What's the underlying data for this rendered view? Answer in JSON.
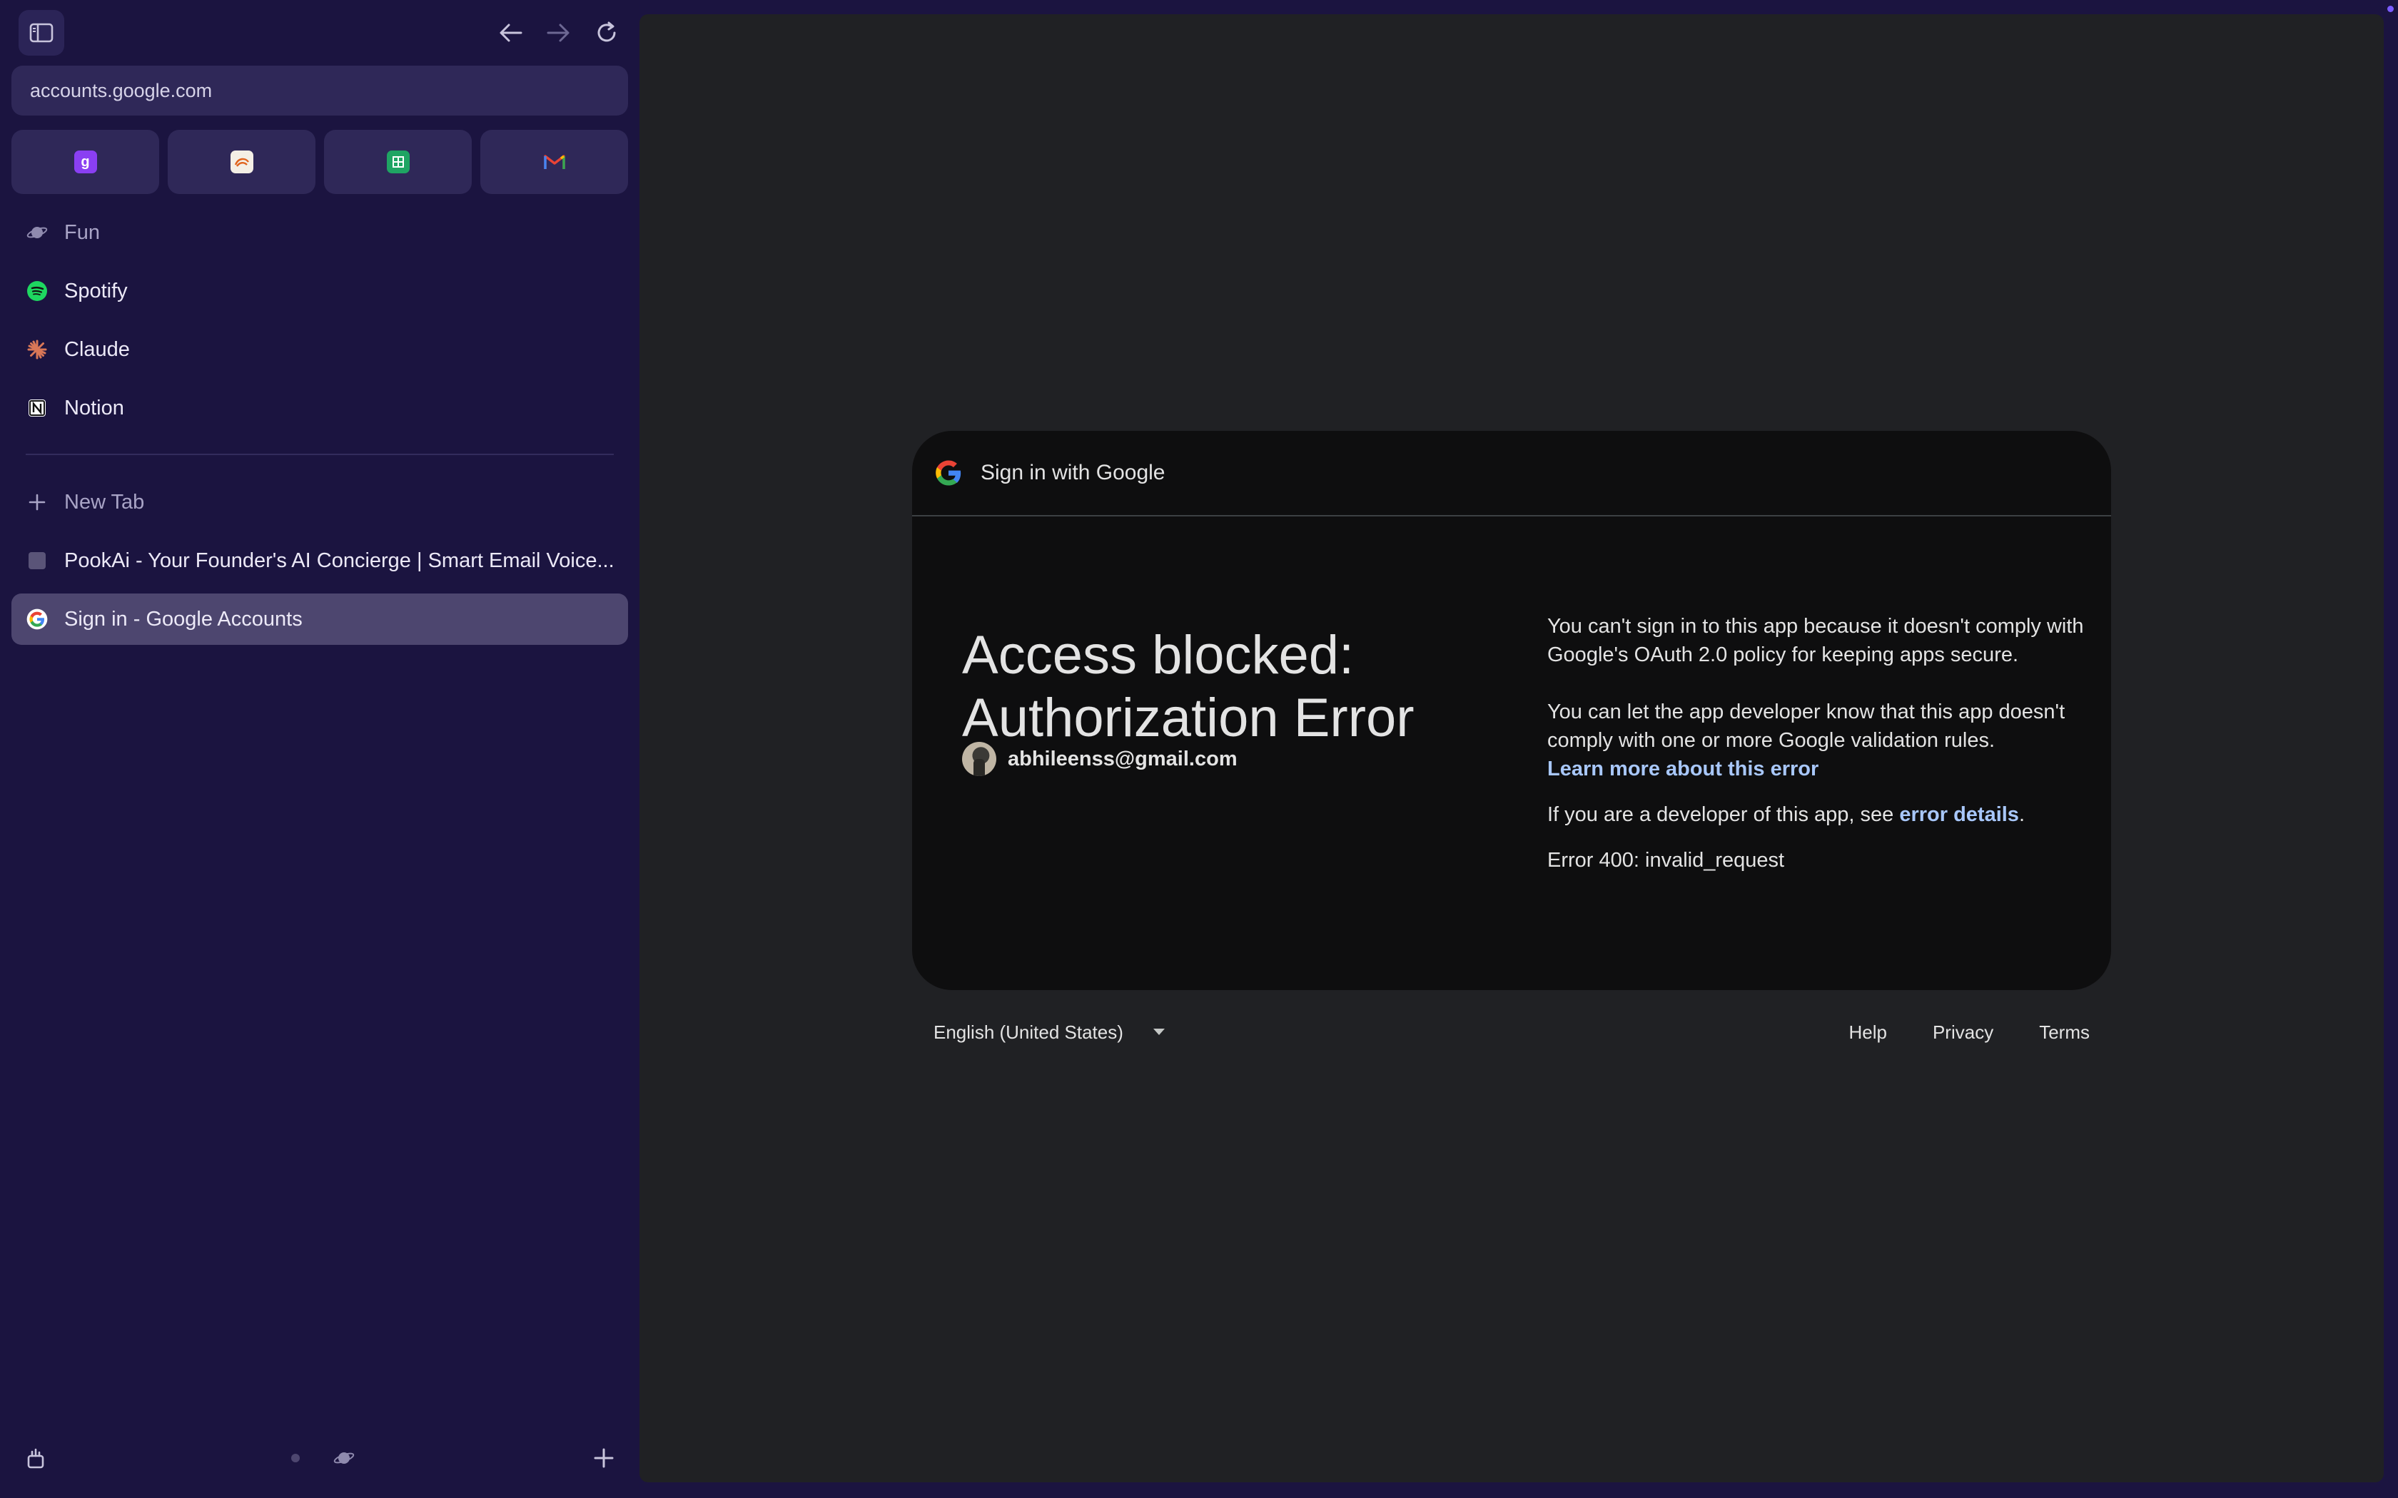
{
  "browser": {
    "url": "accounts.google.com",
    "pinned_tabs": [
      {
        "icon": "gamma-icon",
        "color": "#8a3ff2"
      },
      {
        "icon": "app-icon",
        "color": "#f4efe6"
      },
      {
        "icon": "google-sheets-icon",
        "color": "#1fa463"
      },
      {
        "icon": "gmail-icon",
        "color": "#ea4335"
      }
    ],
    "folder": {
      "label": "Fun",
      "icon": "planet-icon"
    },
    "favorites": [
      {
        "label": "Spotify",
        "icon": "spotify-icon"
      },
      {
        "label": "Claude",
        "icon": "claude-icon"
      },
      {
        "label": "Notion",
        "icon": "notion-icon"
      }
    ],
    "new_tab_label": "New Tab",
    "tabs": [
      {
        "label": "PookAi - Your Founder's AI Concierge | Smart Email Voice...",
        "icon": "pookai-icon"
      },
      {
        "label": "Sign in - Google Accounts",
        "icon": "google-icon",
        "active": true
      }
    ]
  },
  "page": {
    "header": "Sign in with Google",
    "headline_line1": "Access blocked:",
    "headline_line2": "Authorization Error",
    "email": "abhileenss@gmail.com",
    "para1": "You can't sign in to this app because it doesn't comply with Google's OAuth 2.0 policy for keeping apps secure.",
    "para2": "You can let the app developer know that this app doesn't comply with one or more Google validation rules.",
    "learn_more": "Learn more about this error",
    "dev_prefix": "If you are a developer of this app, see ",
    "dev_link": "error details",
    "dev_suffix": ".",
    "error_code": "Error 400: invalid_request",
    "language": "English (United States)",
    "footer_links": {
      "help": "Help",
      "privacy": "Privacy",
      "terms": "Terms"
    }
  },
  "colors": {
    "sidebar_bg": "#1b1440",
    "active_tab": "#4d466f",
    "card_bg": "#0e0e0f",
    "link": "#a8c7fa"
  }
}
